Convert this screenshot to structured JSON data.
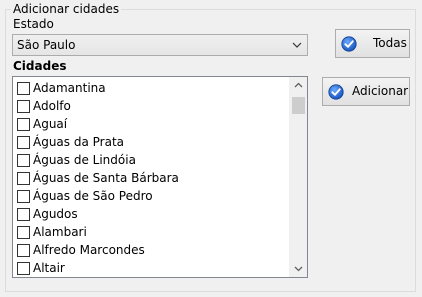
{
  "group": {
    "title": "Adicionar cidades"
  },
  "estado": {
    "label": "Estado",
    "selected": "São Paulo"
  },
  "cidades": {
    "label": "Cidades",
    "items": [
      {
        "label": "Adamantina",
        "checked": false
      },
      {
        "label": "Adolfo",
        "checked": false
      },
      {
        "label": "Aguaí",
        "checked": false
      },
      {
        "label": "Águas da Prata",
        "checked": false
      },
      {
        "label": "Águas de Lindóia",
        "checked": false
      },
      {
        "label": "Águas de Santa Bárbara",
        "checked": false
      },
      {
        "label": "Águas de São Pedro",
        "checked": false
      },
      {
        "label": "Agudos",
        "checked": false
      },
      {
        "label": "Alambari",
        "checked": false
      },
      {
        "label": "Alfredo Marcondes",
        "checked": false
      },
      {
        "label": "Altair",
        "checked": false
      }
    ]
  },
  "buttons": {
    "todas": {
      "label": "Todas",
      "icon": "check-circle-icon"
    },
    "adicionar": {
      "label": "Adicionar",
      "icon": "check-circle-icon"
    }
  },
  "colors": {
    "icon_blue": "#1e6fd9"
  }
}
